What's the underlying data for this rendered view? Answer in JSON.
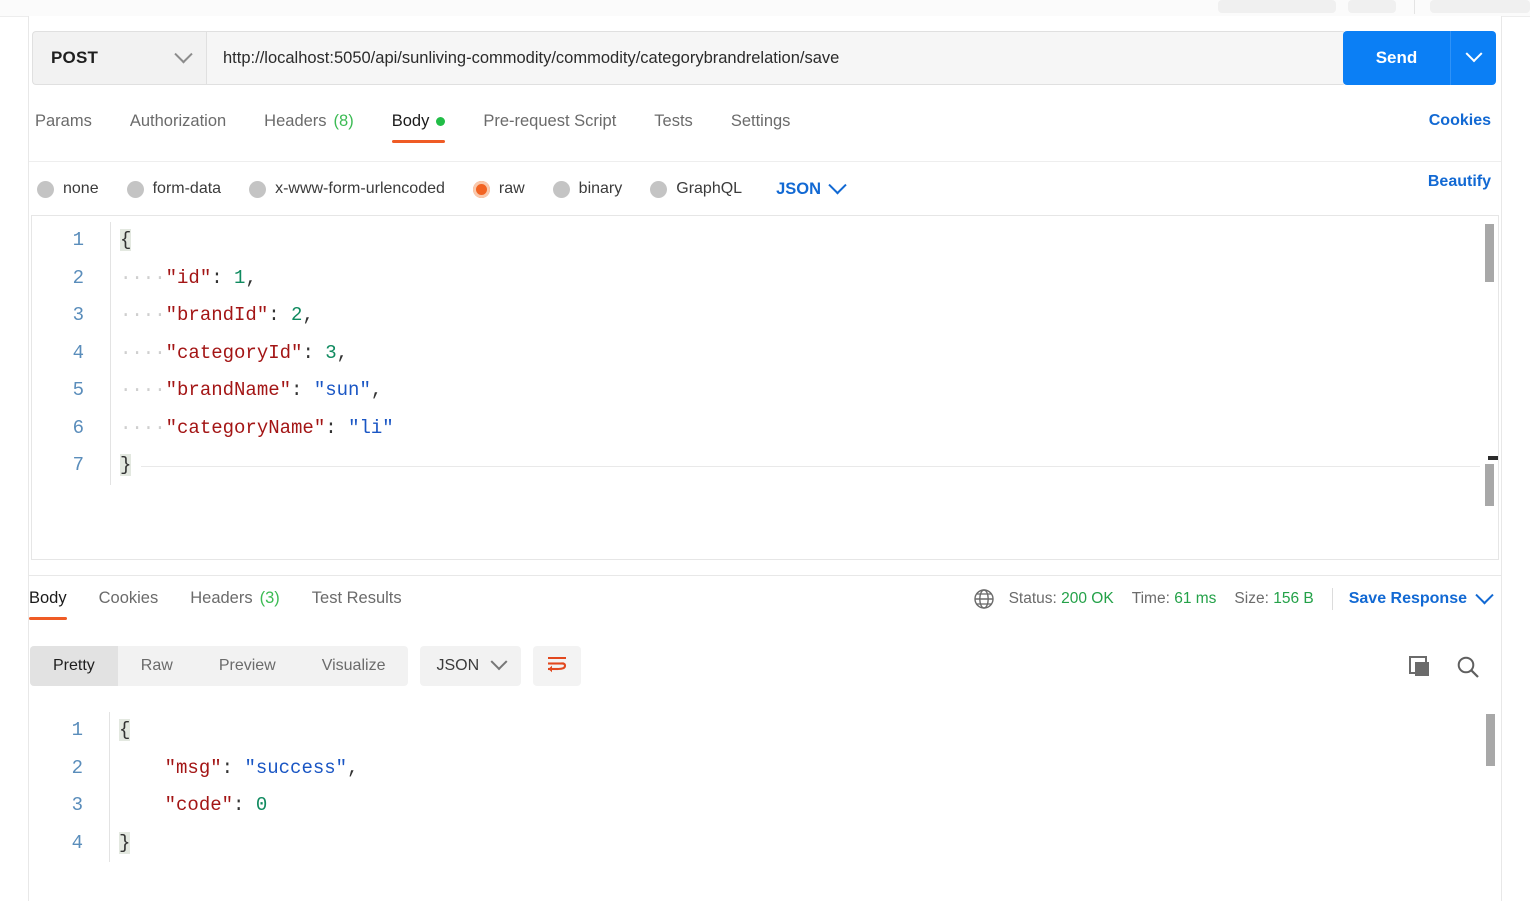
{
  "request": {
    "method": "POST",
    "url": "http://localhost:5050/api/sunliving-commodity/commodity/categorybrandrelation/save",
    "send_label": "Send",
    "tabs": [
      {
        "label": "Params",
        "count": "",
        "active": false
      },
      {
        "label": "Authorization",
        "count": "",
        "active": false
      },
      {
        "label": "Headers",
        "count": "(8)",
        "active": false
      },
      {
        "label": "Body",
        "count": "",
        "active": true
      },
      {
        "label": "Pre-request Script",
        "count": "",
        "active": false
      },
      {
        "label": "Tests",
        "count": "",
        "active": false
      },
      {
        "label": "Settings",
        "count": "",
        "active": false
      }
    ],
    "cookies_label": "Cookies",
    "beautify_label": "Beautify",
    "body_types": [
      {
        "label": "none",
        "selected": false
      },
      {
        "label": "form-data",
        "selected": false
      },
      {
        "label": "x-www-form-urlencoded",
        "selected": false
      },
      {
        "label": "raw",
        "selected": true
      },
      {
        "label": "binary",
        "selected": false
      },
      {
        "label": "GraphQL",
        "selected": false
      }
    ],
    "raw_format": "JSON",
    "body_lines": [
      {
        "n": "1",
        "text": "{"
      },
      {
        "n": "2",
        "text": "    \"id\": 1,"
      },
      {
        "n": "3",
        "text": "    \"brandId\": 2,"
      },
      {
        "n": "4",
        "text": "    \"categoryId\": 3,"
      },
      {
        "n": "5",
        "text": "    \"brandName\": \"sun\","
      },
      {
        "n": "6",
        "text": "    \"categoryName\": \"li\""
      },
      {
        "n": "7",
        "text": "}"
      }
    ]
  },
  "response": {
    "tabs": [
      {
        "label": "Body",
        "count": "",
        "active": true
      },
      {
        "label": "Cookies",
        "count": "",
        "active": false
      },
      {
        "label": "Headers",
        "count": "(3)",
        "active": false
      },
      {
        "label": "Test Results",
        "count": "",
        "active": false
      }
    ],
    "status": {
      "status_label": "Status:",
      "status_value": "200 OK",
      "time_label": "Time:",
      "time_value": "61 ms",
      "size_label": "Size:",
      "size_value": "156 B"
    },
    "save_response_label": "Save Response",
    "view_modes": [
      {
        "label": "Pretty",
        "active": true
      },
      {
        "label": "Raw",
        "active": false
      },
      {
        "label": "Preview",
        "active": false
      },
      {
        "label": "Visualize",
        "active": false
      }
    ],
    "format": "JSON",
    "body_lines": [
      {
        "n": "1",
        "text": "{"
      },
      {
        "n": "2",
        "text": "    \"msg\": \"success\","
      },
      {
        "n": "3",
        "text": "    \"code\": 0"
      },
      {
        "n": "4",
        "text": "}"
      }
    ]
  }
}
